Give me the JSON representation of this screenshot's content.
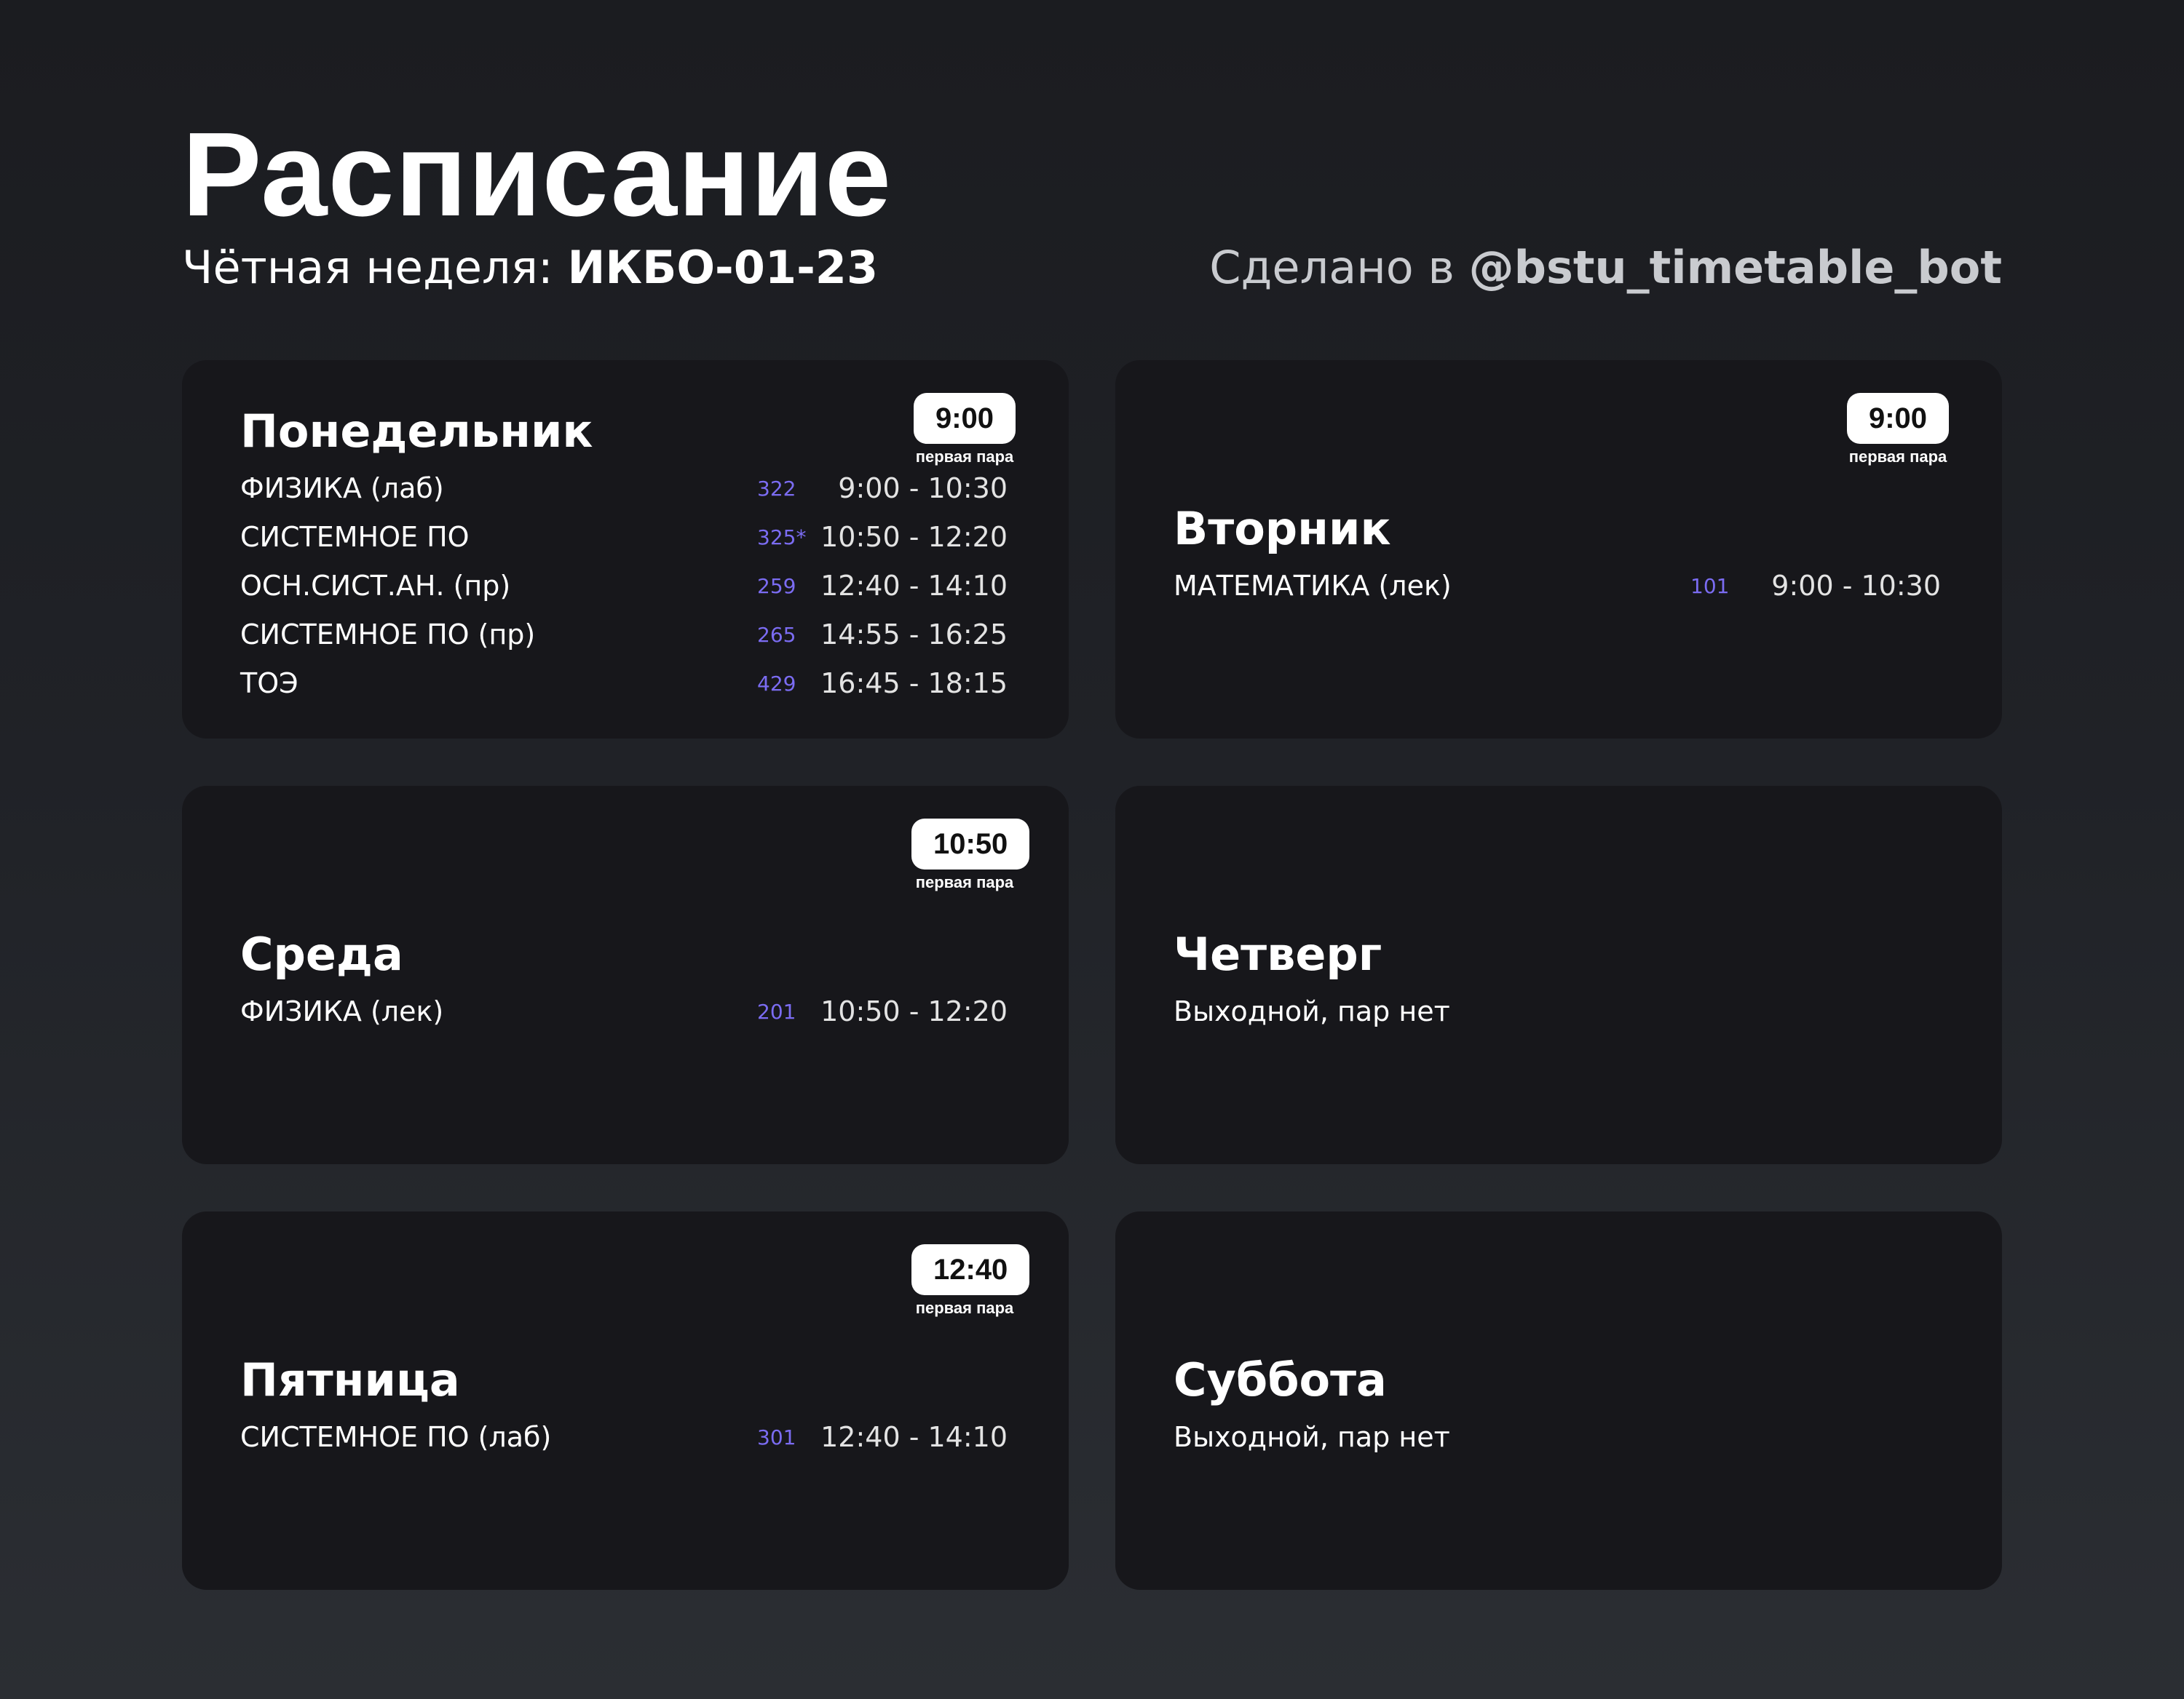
{
  "header": {
    "title": "Расписание",
    "week_label": "Чётная неделя:",
    "group": "ИКБО-01-23",
    "credit_prefix": "Сделано в",
    "bot": "@bstu_timetable_bot"
  },
  "badge_caption": "первая пара",
  "days": [
    {
      "name": "Понедельник",
      "first_time": "9:00",
      "lessons": [
        {
          "name": "ФИЗИКА (лаб)",
          "room": "322",
          "time": "9:00 - 10:30"
        },
        {
          "name": "СИСТЕМНОЕ ПО",
          "room": "325*",
          "time": "10:50 - 12:20"
        },
        {
          "name": "ОСН.СИСТ.АН. (пр)",
          "room": "259",
          "time": "12:40 - 14:10"
        },
        {
          "name": "СИСТЕМНОЕ ПО (пр)",
          "room": "265",
          "time": "14:55 - 16:25"
        },
        {
          "name": "ТОЭ",
          "room": "429",
          "time": "16:45 - 18:15"
        }
      ]
    },
    {
      "name": "Вторник",
      "first_time": "9:00",
      "lessons": [
        {
          "name": "МАТЕМАТИКА (лек)",
          "room": "101",
          "time": "9:00 - 10:30"
        }
      ]
    },
    {
      "name": "Среда",
      "first_time": "10:50",
      "lessons": [
        {
          "name": "ФИЗИКА (лек)",
          "room": "201",
          "time": "10:50 - 12:20"
        }
      ]
    },
    {
      "name": "Четверг",
      "off_text": "Выходной, пар нет"
    },
    {
      "name": "Пятница",
      "first_time": "12:40",
      "lessons": [
        {
          "name": "СИСТЕМНОЕ ПО (лаб)",
          "room": "301",
          "time": "12:40 - 14:10"
        }
      ]
    },
    {
      "name": "Суббота",
      "off_text": "Выходной, пар нет"
    }
  ]
}
